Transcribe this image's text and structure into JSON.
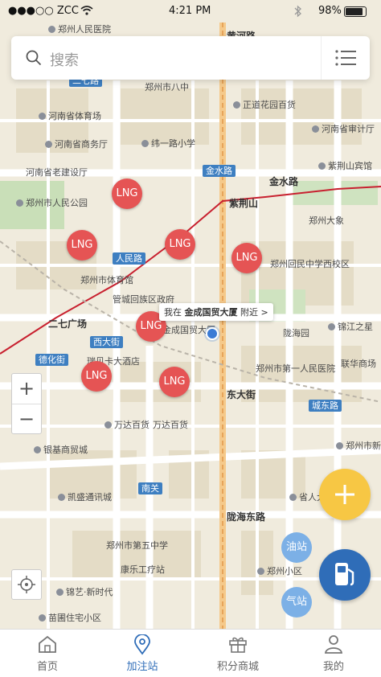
{
  "status_bar": {
    "carrier": "●●●○○ ZCC",
    "time": "4:21 PM",
    "battery": "98%",
    "wifi_icon": "wifi-icon",
    "bluetooth_icon": "bluetooth-icon"
  },
  "search": {
    "placeholder": "搜索"
  },
  "map": {
    "location_tip": {
      "prefix": "我在",
      "place": "金成国贸大厦",
      "suffix": "附近 >"
    },
    "stations": [
      "LNG",
      "LNG",
      "LNG",
      "LNG",
      "LNG",
      "LNG",
      "LNG"
    ],
    "road_tags": [
      "金水路",
      "人民路",
      "西大街",
      "德化街",
      "城东路",
      "南关",
      "二七路"
    ],
    "road_names": [
      "金水路",
      "紫荆山",
      "二七广场",
      "东大街",
      "陇海东路",
      "黄河路"
    ],
    "pois": [
      "郑州人民医院",
      "河南省体育场",
      "河南省商务厅",
      "河南省老建设厅",
      "郑州市人民公园",
      "郑州市体育馆",
      "管城回族区政府",
      "金成国贸大厦",
      "瑞贝卡大酒店",
      "万达百货",
      "银基商贸城",
      "凯盛通讯城",
      "郑州市第五中学",
      "康乐工疗站",
      "锦艺·新时代",
      "苗圃住宅小区",
      "郑州市八中",
      "纬一路小学",
      "正道花园百货",
      "河南省审计厅",
      "紫荆山宾馆",
      "郑州大象",
      "郑州回民中学西校区",
      "锦江之星",
      "郑州市第一人民医院",
      "陇海园",
      "联华商场",
      "郑州市新宾馆",
      "省人大",
      "万达百货",
      "郑州小区"
    ]
  },
  "controls": {
    "zoom_in": "+",
    "zoom_out": "−",
    "oil_label": "油站",
    "gas_label": "气站"
  },
  "tabs": [
    {
      "label": "首页",
      "icon": "home-icon",
      "active": false
    },
    {
      "label": "加注站",
      "icon": "location-pin-icon",
      "active": true
    },
    {
      "label": "积分商城",
      "icon": "gift-icon",
      "active": false
    },
    {
      "label": "我的",
      "icon": "user-icon",
      "active": false
    }
  ],
  "colors": {
    "accent": "#2f6db8",
    "lng_marker": "#e55454",
    "add_button": "#f7c744",
    "station_type": "#7cb0e6"
  }
}
